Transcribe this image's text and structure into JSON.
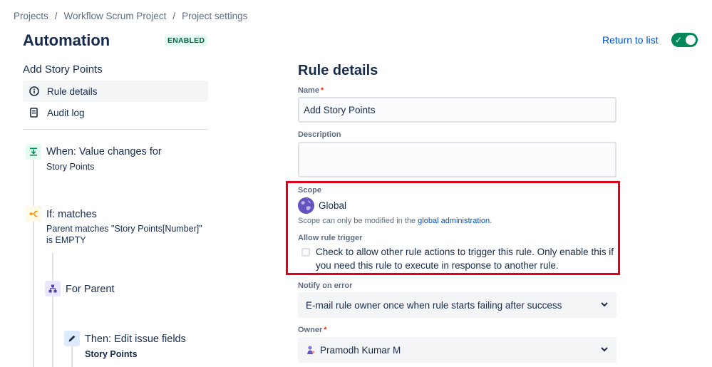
{
  "breadcrumb": [
    "Projects",
    "Workflow Scrum Project",
    "Project settings"
  ],
  "header": {
    "title": "Automation",
    "status_badge": "ENABLED",
    "return_link": "Return to list",
    "rule_enabled": true
  },
  "sidebar": {
    "rule_name": "Add Story Points",
    "nav": [
      {
        "label": "Rule details",
        "icon": "info-icon",
        "active": true
      },
      {
        "label": "Audit log",
        "icon": "document-icon",
        "active": false
      }
    ],
    "steps": [
      {
        "title": "When: Value changes for",
        "subtitle": [
          "Story Points"
        ],
        "icon": "trigger-icon",
        "color": "#e3fcef",
        "icon_color": "#00875a"
      },
      {
        "title": "If: matches",
        "subtitle": [
          "Parent matches \"Story Points[Number]\"",
          "is EMPTY"
        ],
        "icon": "condition-icon",
        "color": "#fffae6",
        "icon_color": "#ff8b00"
      },
      {
        "title": "For Parent",
        "subtitle": [],
        "icon": "branch-icon",
        "color": "#eae6ff",
        "icon_color": "#5243aa"
      },
      {
        "title": "Then: Edit issue fields",
        "subtitle": [
          "Story Points"
        ],
        "icon": "edit-icon",
        "color": "#deebff",
        "icon_color": "#172b4d"
      }
    ]
  },
  "main": {
    "heading": "Rule details",
    "name_label": "Name",
    "name_value": "Add Story Points",
    "description_label": "Description",
    "description_value": "",
    "scope_label": "Scope",
    "scope_value": "Global",
    "scope_help_prefix": "Scope can only be modified in the ",
    "scope_help_link": "global administration",
    "scope_help_suffix": ".",
    "allow_trigger_label": "Allow rule trigger",
    "allow_trigger_text": "Check to allow other rule actions to trigger this rule. Only enable this if you need this rule to execute in response to another rule.",
    "allow_trigger_checked": false,
    "notify_label": "Notify on error",
    "notify_value": "E-mail rule owner once when rule starts failing after success",
    "owner_label": "Owner",
    "owner_value": "Pramodh Kumar M"
  },
  "colors": {
    "accent": "#0052cc",
    "success": "#00875a",
    "highlight": "#e0001b"
  }
}
